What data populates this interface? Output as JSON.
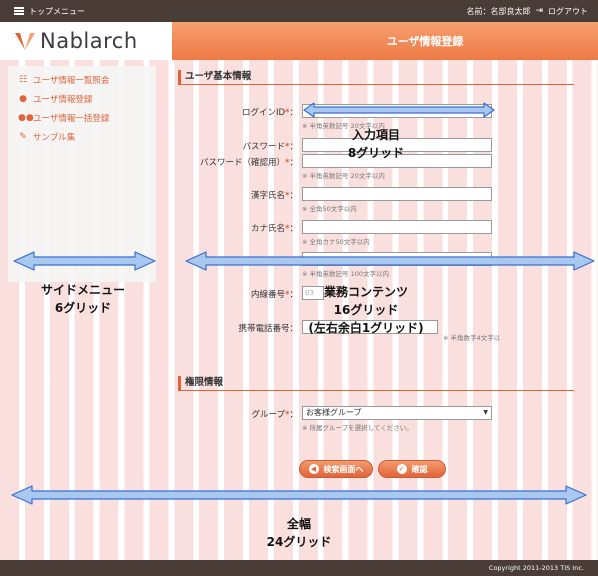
{
  "topbar": {
    "menu_label": "トップメニュー",
    "user_name": "名前：名部良太郎",
    "logout_label": "ログアウト"
  },
  "header": {
    "logo_text": "Nablarch",
    "page_title": "ユーザ情報登録"
  },
  "sidebar": {
    "items": [
      {
        "label": "ユーザ情報一覧照会",
        "icon": "list-icon"
      },
      {
        "label": "ユーザ情報登録",
        "icon": "user-icon"
      },
      {
        "label": "ユーザ情報一括登録",
        "icon": "users-icon"
      },
      {
        "label": "サンプル集",
        "icon": "wrench-icon"
      }
    ]
  },
  "form": {
    "section_basic": "ユーザ基本情報",
    "login_id": {
      "label": "ログインID",
      "hint": "※ 半角英数記号 20文字以内"
    },
    "password": {
      "label": "パスワード"
    },
    "password_confirm": {
      "label": "パスワード（確認用）",
      "hint": "※ 半角英数記号 20文字以内"
    },
    "kanji_name": {
      "label": "漢字氏名",
      "hint": "※ 全角50文字以内"
    },
    "kana_name": {
      "label": "カナ氏名",
      "hint": "※ 全角カナ50文字以内"
    },
    "mail_hint": "※ 半角英数記号 100文字以内",
    "extension": {
      "label": "内線番号",
      "value": "03"
    },
    "mobile": {
      "label": "携帯電話番号",
      "hint": "※ 半角数字4文字以"
    },
    "section_permission": "権限情報",
    "group": {
      "label": "グループ",
      "value": "お客様グループ",
      "hint": "※ 所属グループを選択してください。"
    },
    "required_mark": "*",
    "colon": "："
  },
  "buttons": {
    "back_label": "検索画面へ",
    "confirm_label": "確認"
  },
  "footer": {
    "copyright": "Copyright 2011-2013 TIS Inc."
  },
  "annotations": {
    "input_items": "入力項目",
    "input_items_grid": "8グリッド",
    "side_menu": "サイドメニュー",
    "side_menu_grid": "6グリッド",
    "business_content": "業務コンテンツ",
    "business_content_grid": "16グリッド",
    "business_content_margin": "(左右余白1グリッド)",
    "full_width": "全幅",
    "full_width_grid": "24グリッド"
  },
  "colors": {
    "accent": "#e0643a",
    "bar": "#4a3c37",
    "arrow": "#3a6fd0",
    "grid": "#ee9696"
  }
}
